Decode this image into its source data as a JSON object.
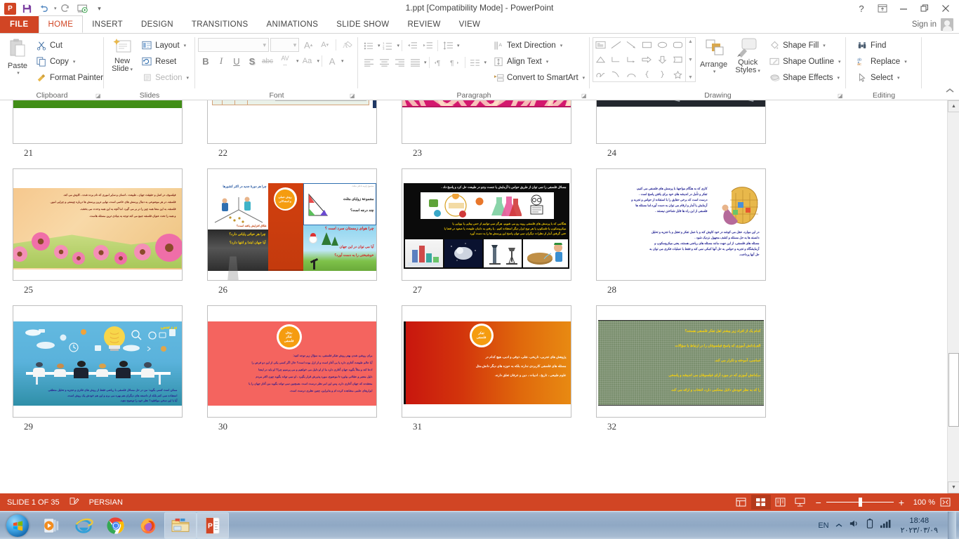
{
  "window": {
    "title": "1.ppt [Compatibility Mode] - PowerPoint",
    "signin_label": "Sign in",
    "help_icon": "?",
    "ribbon_display_icon": "ribbon-display-options-icon",
    "minimize_icon": "minimize-icon",
    "restore_icon": "restore-icon",
    "close_icon": "close-icon"
  },
  "quick_access": {
    "app_logo": "powerpoint-logo",
    "save": "save-icon",
    "undo": "undo-icon",
    "redo": "redo-icon",
    "start_slideshow": "start-from-beginning-icon",
    "customize": "customize-quick-access-toolbar-icon"
  },
  "tabs": [
    {
      "label": "FILE",
      "active": false,
      "is_file": true
    },
    {
      "label": "HOME",
      "active": true,
      "is_file": false
    },
    {
      "label": "INSERT",
      "active": false,
      "is_file": false
    },
    {
      "label": "DESIGN",
      "active": false,
      "is_file": false
    },
    {
      "label": "TRANSITIONS",
      "active": false,
      "is_file": false
    },
    {
      "label": "ANIMATIONS",
      "active": false,
      "is_file": false
    },
    {
      "label": "SLIDE SHOW",
      "active": false,
      "is_file": false
    },
    {
      "label": "REVIEW",
      "active": false,
      "is_file": false
    },
    {
      "label": "VIEW",
      "active": false,
      "is_file": false
    }
  ],
  "ribbon": {
    "clipboard": {
      "label": "Clipboard",
      "paste": "Paste",
      "cut": "Cut",
      "copy": "Copy",
      "format_painter": "Format Painter"
    },
    "slides": {
      "label": "Slides",
      "new_slide": "New\nSlide",
      "new_slide_line1": "New",
      "new_slide_line2": "Slide",
      "layout": "Layout",
      "reset": "Reset",
      "section": "Section"
    },
    "font": {
      "label": "Font",
      "font_name_value": "",
      "font_size_value": "",
      "grow_font": "A",
      "shrink_font": "A",
      "clear_formatting": "clear-formatting-icon",
      "bold": "B",
      "italic": "I",
      "underline": "U",
      "shadow": "S",
      "strikethrough": "abc",
      "character_spacing": "AV",
      "change_case": "Aa",
      "font_color": "A"
    },
    "paragraph": {
      "label": "Paragraph",
      "text_direction": "Text Direction",
      "align_text": "Align Text",
      "convert_to_smartart": "Convert to SmartArt"
    },
    "drawing": {
      "label": "Drawing",
      "arrange": "Arrange",
      "quick_styles_line1": "Quick",
      "quick_styles_line2": "Styles",
      "shape_fill": "Shape Fill",
      "shape_outline": "Shape Outline",
      "shape_effects": "Shape Effects"
    },
    "editing": {
      "label": "Editing",
      "find": "Find",
      "replace": "Replace",
      "select": "Select",
      "collapse_ribbon": "collapse-ribbon-icon"
    }
  },
  "slides": [
    {
      "number": "21",
      "style": "s21",
      "partial": true
    },
    {
      "number": "22",
      "style": "s22",
      "partial": true
    },
    {
      "number": "23",
      "style": "s23",
      "partial": true
    },
    {
      "number": "24",
      "style": "s24",
      "partial": true
    },
    {
      "number": "25",
      "style": "s25",
      "partial": false,
      "lines": [
        "فیلسوف در اصل و حقیقت جهان ، طبیعت ، انسان و سایر اموری که نام برده شده ، کاوش می کند.",
        "فلسفه، در هر موضوعی به دنبال پرسش های خاصی است، نهایی ترین پرسش ها درباره چیستی و چرایی امور.",
        "فلسفه، به این معنا همه چیز را در بر می گیرد. اما آنچه به این همه وحدت می بخشد،",
        "و همه را تحت عنوان فلسفه جمع می کند توجه به بنیادی ترین مسئله هاست."
      ]
    },
    {
      "number": "26",
      "style": "s26",
      "partial": false,
      "panels": {
        "top_left": "چرا هر دورهٔ جدید در اکثر کشورها",
        "top_left_sub": "طلاق افزایش یافته است؟",
        "mid_dark": "چرا هر حیاتی پایانی دارد؟",
        "mid_dark2": "آیا جهان ابتدا و انتها دارد؟",
        "badge_line1": "روش عملی",
        "badge_line2": "و استدلالی",
        "right_top_header": "مجموع زاویه داخلی مثلث",
        "right_top1": "مجموعهٔ زوایای مثلث",
        "right_top2": "چند درجه است؟",
        "right_bottom1": "چرا هوای زمستان سرد است ؟",
        "right_bottom2": "آیا می توان در این جهان",
        "right_bottom3": "خوشبختی را به دست آورد؟"
      }
    },
    {
      "number": "27",
      "style": "s27",
      "partial": false,
      "top_line": "مسائل فلسفی را نمی توان از طریق حواس با آزمایش یا جست وجو در طبیعت حل کرد و پاسخ داد .",
      "lines": [
        "هنگامی که با  پرسش های فلسفی  روبه رو می شویم، هرگز نمی توانیم از حس بینایی یا بویایی یا",
        "میکروسکوپ یا تلسکوپ یا هر نوع ابزار دیگر استفاده کنیم . یا رفتن به دامان طبیعت یا صعود در فضا یا",
        "حتی گرفتن آمار از نظرات دیگران نمی توان پاسخ این پرسش ها را به دست آورد"
      ]
    },
    {
      "number": "28",
      "style": "s28",
      "partial": false,
      "lines": [
        "کاری که به هنگام مواجههٔ با  پرسش های فلسفی  می کنیم،",
        "تفکر و تأمل در اندیشه های خود برای یافتن پاسخ است .",
        "درست است که برخی حقایق را با استفاده از حواس و تجربه و",
        "آزمایش یا آمار و ارقام می توان به دست آورد.اما مسئله ها",
        "فلسفی از این راه ها قابل شناختن نیستند .",
        "در این موارد، عقل می کوشد در خود کاوش کند و با عمل تفکر و تعقل و با تجزیه و تحلیل",
        "دانسته ها به حل مسئله و کشف مجهول نزدیک شود .",
        "مسئله های فلسفی، از این جهت مانند مسئله های ریاضی هستند، یعنی میکروسکوپ و",
        "آزمایشگاه و تجربه و حواس به حل آنها کمکی نمی کند و فقط با عملیات فکری می توان به",
        "حل آنها پرداخت."
      ]
    },
    {
      "number": "29",
      "style": "s29",
      "partial": false,
      "title": "بررسی",
      "lines": [
        "ممکن است کسی بگوید: من در حل مسائل فلسفی با ریاضی فقط از روش های فکری و تجزیه و تحلیل منطقی",
        "استفاده نمی کنم بلکه از دانسته های دیگران هم بهره می برم و این هم خودش یک روش است.",
        "آیا با این سخن موافقید؟ نظر خود را توضیح دهید."
      ]
    },
    {
      "number": "30",
      "style": "s30",
      "partial": false,
      "badge_line1": "روش",
      "badge_line2": "تفکر",
      "badge_line3": "فلسفی",
      "lines": [
        "برای روشن شدن بهتر روش تفکر فلسفی، به سؤال زیر توجه کنید:",
        "آیا  عالم طبیعت آغازی دارد یا بی آغاز است و از ازل بوده است؟ حال اگر کسی یکی از این دو فرض را",
        "ادعا کند و مثلاً بگوید جهان آغازی دارد ما از او دلیل می خواهیم و می پرسیم چرا؟  او باید در اینجا",
        "دلیل معتبر و عقلانی بیاورد تا موضوع،  مورد پذیرش قرار بگیرد  ، او نمی تواند بگوید چون اکثر مردم",
        "معتقدند که جهان آغازی دارد، پس این امر نظر درست است .همچنین نمی تواند بگوید من آغاز جهان را با",
        "ابزارهای علمی مشاهده کرده ام و بنابراین، چنین نظری درست است."
      ]
    },
    {
      "number": "31",
      "style": "s31",
      "partial": false,
      "badge_line1": "تفکر",
      "badge_line2": "فلسفی",
      "lines": [
        "پژوهش های تجربی، تاریخی، نقلی، ذوقی و ادبی، هیچ کدام در",
        "مسئله های فلسفی کاربردی ندارند بلکه به حوزه های دیگر دانش،مثل",
        "علوم طبیعی ، تاریخ ، ادبیات ، دین و عرفان تعلق دارند."
      ]
    },
    {
      "number": "32",
      "style": "s32",
      "partial": false,
      "lines": [
        "کدام یک از افراد زیر بیشتر اهل تفکر فلسفی هستند؟",
        "الف)دانش آموزی که پاسخ فیلسوفان را در ارتباط با سؤالات",
        "اساسی، آموخته و تکرار می کند.",
        "ب)دانش آموزی که در مورد آرای فیلسوفان می اندیشد و پاسخی",
        "را که به نظر خودش دلایل محکمی دارد، انتخاب و ارائه می کند."
      ]
    }
  ],
  "status_bar": {
    "slide_indicator": "SLIDE 1 OF 35",
    "notes_icon": "notes-icon",
    "language": "PERSIAN",
    "view_normal": "normal-view-icon",
    "view_slide_sorter": "slide-sorter-view-icon",
    "view_reading": "reading-view-icon",
    "view_slideshow": "slide-show-icon",
    "zoom_out": "−",
    "zoom_in": "+",
    "zoom_level": "100 %",
    "fit_to_window": "fit-slide-to-window-icon"
  },
  "taskbar": {
    "start": "windows-start-orb",
    "items": [
      {
        "name": "windows-media-player-icon",
        "open": false
      },
      {
        "name": "internet-explorer-icon",
        "open": false
      },
      {
        "name": "google-chrome-icon",
        "open": false
      },
      {
        "name": "mozilla-firefox-icon",
        "open": false
      },
      {
        "name": "file-explorer-icon",
        "open": true
      },
      {
        "name": "powerpoint-taskbar-icon",
        "open": true
      }
    ],
    "tray": {
      "show_hidden_icons": "show-hidden-icons-chevron",
      "language": "EN",
      "volume": "volume-icon",
      "battery": "battery-icon",
      "network": "network-signal-icon",
      "time": "18:48",
      "date": "۲۰۲۳/۰۳/۰۹"
    }
  },
  "colors": {
    "accent": "#d14524",
    "ribbon_bg": "#ffffff",
    "taskbar": "#9db3cc"
  }
}
